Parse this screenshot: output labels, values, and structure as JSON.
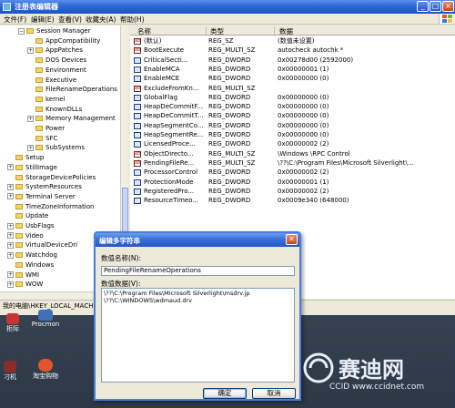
{
  "window": {
    "title": "注册表编辑器",
    "menu": [
      "文件(F)",
      "编辑(E)",
      "查看(V)",
      "收藏夹(A)",
      "帮助(H)"
    ]
  },
  "tree": {
    "items": [
      {
        "label": "Session Manager",
        "expander": "−"
      },
      {
        "label": "AppCompatibility",
        "expander": ""
      },
      {
        "label": "AppPatches",
        "expander": "+"
      },
      {
        "label": "DOS Devices",
        "expander": ""
      },
      {
        "label": "Environment",
        "expander": ""
      },
      {
        "label": "Executive",
        "expander": ""
      },
      {
        "label": "FileRenameOperations",
        "expander": ""
      },
      {
        "label": "kernel",
        "expander": ""
      },
      {
        "label": "KnownDLLs",
        "expander": ""
      },
      {
        "label": "Memory Management",
        "expander": "+"
      },
      {
        "label": "Power",
        "expander": ""
      },
      {
        "label": "SFC",
        "expander": ""
      },
      {
        "label": "SubSystems",
        "expander": "+"
      },
      {
        "label": "Setup",
        "expander": ""
      },
      {
        "label": "StillImage",
        "expander": "+"
      },
      {
        "label": "StorageDevicePolicies",
        "expander": ""
      },
      {
        "label": "SystemResources",
        "expander": "+"
      },
      {
        "label": "Terminal Server",
        "expander": "+"
      },
      {
        "label": "TimeZoneInformation",
        "expander": ""
      },
      {
        "label": "Update",
        "expander": ""
      },
      {
        "label": "UsbFlags",
        "expander": "+"
      },
      {
        "label": "Video",
        "expander": "+"
      },
      {
        "label": "VirtualDeviceDri",
        "expander": "+"
      },
      {
        "label": "Watchdog",
        "expander": "+"
      },
      {
        "label": "Windows",
        "expander": ""
      },
      {
        "label": "WMI",
        "expander": "+"
      },
      {
        "label": "WOW",
        "expander": "+"
      }
    ]
  },
  "list": {
    "headers": {
      "name": "名称",
      "type": "类型",
      "data": "数据"
    },
    "rows": [
      {
        "name": "(默认)",
        "type": "REG_SZ",
        "data": "(数值未设置)",
        "kind": "sz"
      },
      {
        "name": "BootExecute",
        "type": "REG_MULTI_SZ",
        "data": "autocheck autochk *",
        "kind": "sz"
      },
      {
        "name": "CriticalSecti...",
        "type": "REG_DWORD",
        "data": "0x00278d00 (2592000)",
        "kind": "bin"
      },
      {
        "name": "EnableMCA",
        "type": "REG_DWORD",
        "data": "0x00000001 (1)",
        "kind": "bin"
      },
      {
        "name": "EnableMCE",
        "type": "REG_DWORD",
        "data": "0x00000000 (0)",
        "kind": "bin"
      },
      {
        "name": "ExcludeFromKn...",
        "type": "REG_MULTI_SZ",
        "data": "",
        "kind": "sz"
      },
      {
        "name": "GlobalFlag",
        "type": "REG_DWORD",
        "data": "0x00000000 (0)",
        "kind": "bin"
      },
      {
        "name": "HeapDeCommitF...",
        "type": "REG_DWORD",
        "data": "0x00000000 (0)",
        "kind": "bin"
      },
      {
        "name": "HeapDeCommitT...",
        "type": "REG_DWORD",
        "data": "0x00000000 (0)",
        "kind": "bin"
      },
      {
        "name": "HeapSegmentCo...",
        "type": "REG_DWORD",
        "data": "0x00000000 (0)",
        "kind": "bin"
      },
      {
        "name": "HeapSegmentRe...",
        "type": "REG_DWORD",
        "data": "0x00000000 (0)",
        "kind": "bin"
      },
      {
        "name": "LicensedProce...",
        "type": "REG_DWORD",
        "data": "0x00000002 (2)",
        "kind": "bin"
      },
      {
        "name": "ObjectDirecto...",
        "type": "REG_MULTI_SZ",
        "data": "\\Windows \\RPC Control",
        "kind": "sz"
      },
      {
        "name": "PendingFileRe...",
        "type": "REG_MULTI_SZ",
        "data": "\\??\\C:\\Program Files\\Microsoft Silverlight\\...",
        "kind": "sz"
      },
      {
        "name": "ProcessorControl",
        "type": "REG_DWORD",
        "data": "0x00000002 (2)",
        "kind": "bin"
      },
      {
        "name": "ProtectionMode",
        "type": "REG_DWORD",
        "data": "0x00000001 (1)",
        "kind": "bin"
      },
      {
        "name": "RegisteredPro...",
        "type": "REG_DWORD",
        "data": "0x00000002 (2)",
        "kind": "bin"
      },
      {
        "name": "ResourceTimeo...",
        "type": "REG_DWORD",
        "data": "0x0009e340 (648000)",
        "kind": "bin"
      }
    ]
  },
  "status": {
    "path": "我的电脑\\HKEY_LOCAL_MACHINE"
  },
  "desktop": {
    "icons": [
      {
        "label": "拒际"
      },
      {
        "label": "Procmon"
      },
      {
        "label": "刁机"
      },
      {
        "label": "淘宝购物"
      }
    ]
  },
  "dialog": {
    "title": "编辑多字符串",
    "name_label": "数值名称(N):",
    "name_value": "PendingFileRenameOperations",
    "data_label": "数值数据(V):",
    "data_lines": [
      "\\??\\C:\\Program Files\\Microsoft Silverlight\\msdrv.jp",
      "\\??\\C:\\WINDOWS\\wdmaud.drv"
    ],
    "ok_label": "确定",
    "cancel_label": "取消",
    "close_glyph": "✕"
  },
  "watermark": {
    "brand": "赛迪网",
    "url": "CCID www.ccidnet.com"
  },
  "colors": {
    "titlebar": "#2f6ad8",
    "folder": "#f2d36b",
    "dialog_border": "#4a7ce0"
  }
}
